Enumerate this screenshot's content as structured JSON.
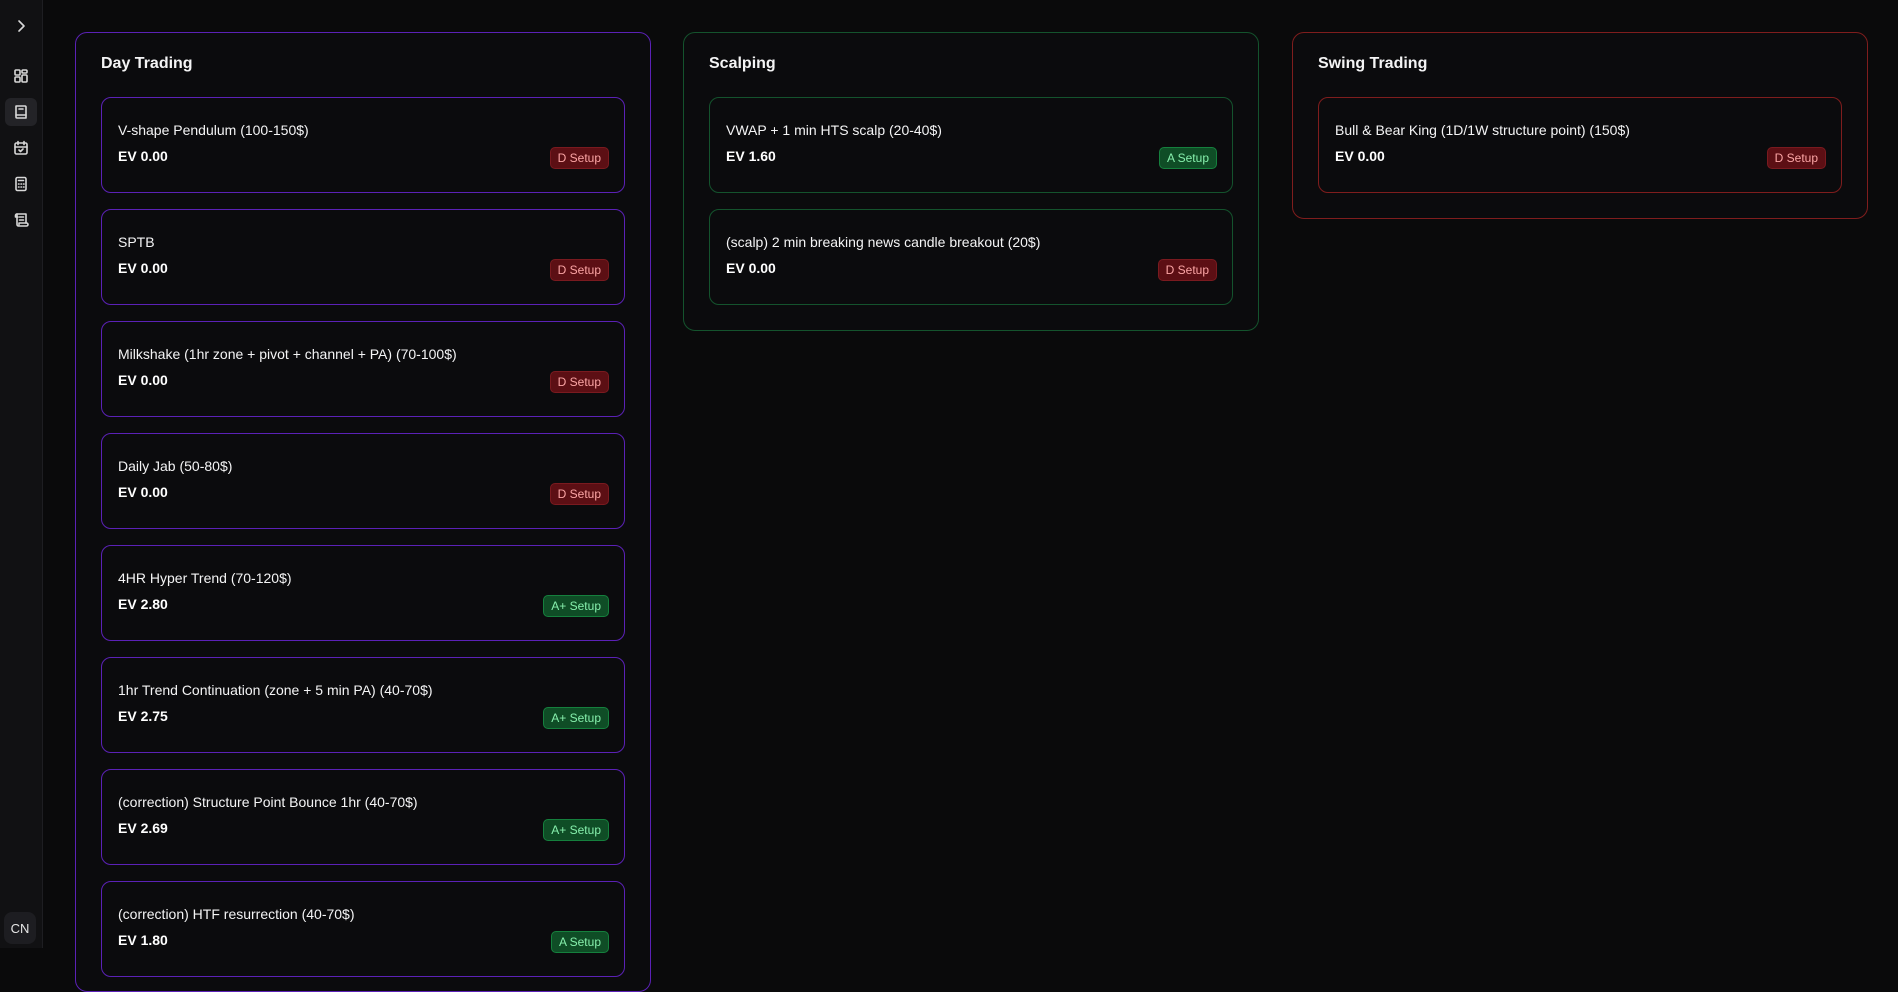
{
  "sidebar": {
    "avatar": "CN"
  },
  "colors": {
    "day_trading_border": "#5b21b6",
    "scalping_border": "#14532d",
    "swing_trading_border": "#7f1d1d",
    "d_setup_badge": "#5c0f14",
    "a_setup_badge": "#0f4d26"
  },
  "columns": [
    {
      "title": "Day Trading",
      "cards": [
        {
          "title": "V-shape Pendulum (100-150$)",
          "ev": "EV 0.00",
          "badge": "D Setup",
          "grade": "D"
        },
        {
          "title": "SPTB",
          "ev": "EV 0.00",
          "badge": "D Setup",
          "grade": "D"
        },
        {
          "title": "Milkshake (1hr zone + pivot + channel + PA) (70-100$)",
          "ev": "EV 0.00",
          "badge": "D Setup",
          "grade": "D"
        },
        {
          "title": "Daily Jab (50-80$)",
          "ev": "EV 0.00",
          "badge": "D Setup",
          "grade": "D"
        },
        {
          "title": "4HR Hyper Trend (70-120$)",
          "ev": "EV 2.80",
          "badge": "A+ Setup",
          "grade": "Aplus"
        },
        {
          "title": "1hr Trend Continuation (zone + 5 min PA) (40-70$)",
          "ev": "EV 2.75",
          "badge": "A+ Setup",
          "grade": "Aplus"
        },
        {
          "title": "(correction) Structure Point Bounce 1hr (40-70$)",
          "ev": "EV 2.69",
          "badge": "A+ Setup",
          "grade": "Aplus"
        },
        {
          "title": "(correction) HTF resurrection (40-70$)",
          "ev": "EV 1.80",
          "badge": "A Setup",
          "grade": "A"
        }
      ]
    },
    {
      "title": "Scalping",
      "cards": [
        {
          "title": "VWAP + 1 min HTS scalp (20-40$)",
          "ev": "EV 1.60",
          "badge": "A Setup",
          "grade": "A"
        },
        {
          "title": "(scalp) 2 min breaking news candle breakout (20$)",
          "ev": "EV 0.00",
          "badge": "D Setup",
          "grade": "D"
        }
      ]
    },
    {
      "title": "Swing Trading",
      "cards": [
        {
          "title": "Bull & Bear King (1D/1W structure point) (150$)",
          "ev": "EV 0.00",
          "badge": "D Setup",
          "grade": "D"
        }
      ]
    }
  ]
}
